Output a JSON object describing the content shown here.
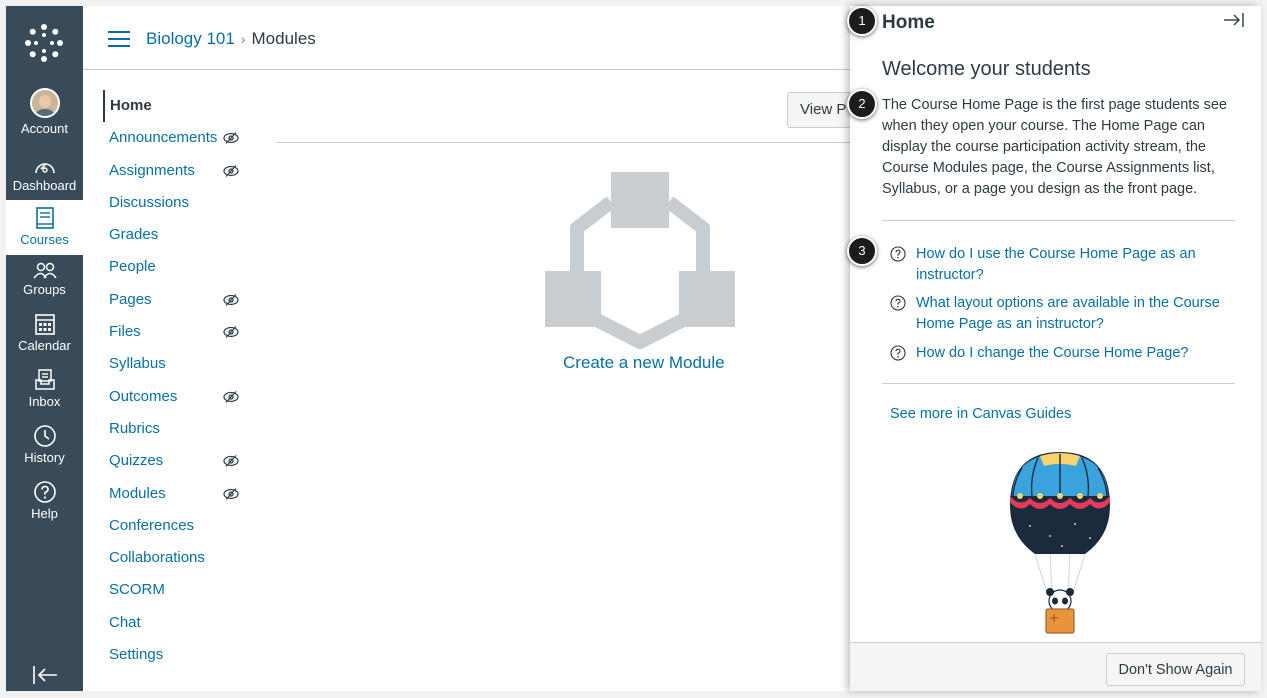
{
  "global_nav": {
    "items": [
      {
        "label": "Account",
        "icon": "avatar"
      },
      {
        "label": "Dashboard",
        "icon": "dashboard-icon"
      },
      {
        "label": "Courses",
        "icon": "courses-icon"
      },
      {
        "label": "Groups",
        "icon": "groups-icon"
      },
      {
        "label": "Calendar",
        "icon": "calendar-icon"
      },
      {
        "label": "Inbox",
        "icon": "inbox-icon"
      },
      {
        "label": "History",
        "icon": "history-icon"
      },
      {
        "label": "Help",
        "icon": "help-icon"
      }
    ],
    "active_item": "Courses",
    "colors": {
      "background": "#394b58",
      "active_text": "#0770a2",
      "link": "#0770a2"
    }
  },
  "breadcrumb": {
    "course": "Biology 101",
    "separator": "›",
    "current": "Modules"
  },
  "course_nav": {
    "items": [
      {
        "label": "Home",
        "active": true,
        "hidden": false
      },
      {
        "label": "Announcements",
        "hidden": true
      },
      {
        "label": "Assignments",
        "hidden": true
      },
      {
        "label": "Discussions",
        "hidden": false
      },
      {
        "label": "Grades",
        "hidden": false
      },
      {
        "label": "People",
        "hidden": false
      },
      {
        "label": "Pages",
        "hidden": true
      },
      {
        "label": "Files",
        "hidden": true
      },
      {
        "label": "Syllabus",
        "hidden": false
      },
      {
        "label": "Outcomes",
        "hidden": true
      },
      {
        "label": "Rubrics",
        "hidden": false
      },
      {
        "label": "Quizzes",
        "hidden": true
      },
      {
        "label": "Modules",
        "hidden": true
      },
      {
        "label": "Conferences",
        "hidden": false
      },
      {
        "label": "Collaborations",
        "hidden": false
      },
      {
        "label": "SCORM",
        "hidden": false
      },
      {
        "label": "Chat",
        "hidden": false
      },
      {
        "label": "Settings",
        "hidden": false
      }
    ]
  },
  "content": {
    "view_button_label": "View P",
    "create_module_link": "Create a new Module"
  },
  "tray": {
    "title": "Home",
    "subtitle": "Welcome your students",
    "description": "The Course Home Page is the first page students see when they open your course. The Home Page can display the course participation activity stream, the Course Modules page, the Course Assignments list, Syllabus, or a page you design as the front page.",
    "links": [
      "How do I use the Course Home Page as an instructor?",
      "What layout options are available in the Course Home Page as an instructor?",
      "How do I change the Course Home Page?"
    ],
    "see_more": "See more in Canvas Guides",
    "dont_show_label": "Don't Show Again"
  },
  "callouts": [
    "1",
    "2",
    "3"
  ]
}
